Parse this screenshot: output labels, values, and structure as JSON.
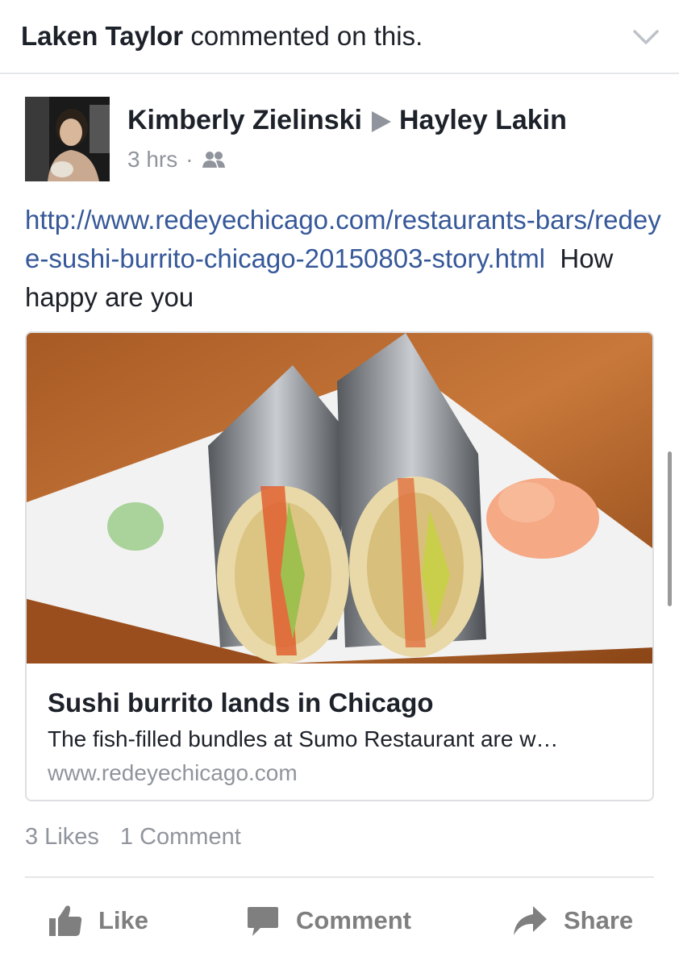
{
  "notification": {
    "actor": "Laken Taylor",
    "action": "commented on this.",
    "menu_icon": "chevron-down-icon"
  },
  "post": {
    "author": "Kimberly Zielinski",
    "target": "Hayley Lakin",
    "time": "3 hrs",
    "audience_icon": "friends-icon",
    "link_text": "http://www.redeyechicago.com/restaurants-bars/redeye-sushi-burrito-chicago-20150803-story.html",
    "message": "How happy are you"
  },
  "link_card": {
    "title": "Sushi burrito lands in Chicago",
    "description": "The fish-filled bundles at Sumo Restaurant are w…",
    "domain": "www.redeyechicago.com"
  },
  "stats": {
    "likes": "3 Likes",
    "comments": "1 Comment"
  },
  "actions": {
    "like": "Like",
    "comment": "Comment",
    "share": "Share"
  },
  "colors": {
    "link": "#365899",
    "secondary_text": "#90949c",
    "action_gray": "#7f7f7f"
  }
}
